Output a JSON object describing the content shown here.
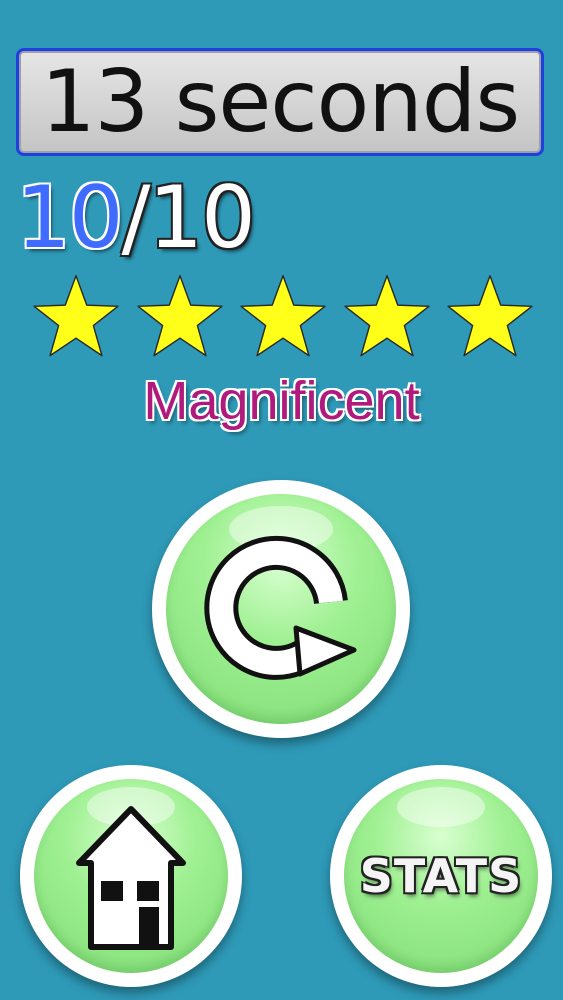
{
  "timer": {
    "label": "13 seconds"
  },
  "score": {
    "correct": "10",
    "total_part": "/10"
  },
  "rating": {
    "stars_earned": 5,
    "stars_max": 5,
    "label": "Magnificent",
    "star_color": "#ffff1a"
  },
  "buttons": {
    "replay": {
      "icon": "replay-icon"
    },
    "home": {
      "icon": "house-icon"
    },
    "stats": {
      "label": "STATS"
    }
  },
  "colors": {
    "background": "#2e9ab8",
    "button_green": "#9ff092",
    "rating_text": "#b01a7c",
    "score_blue": "#3f6bff"
  }
}
